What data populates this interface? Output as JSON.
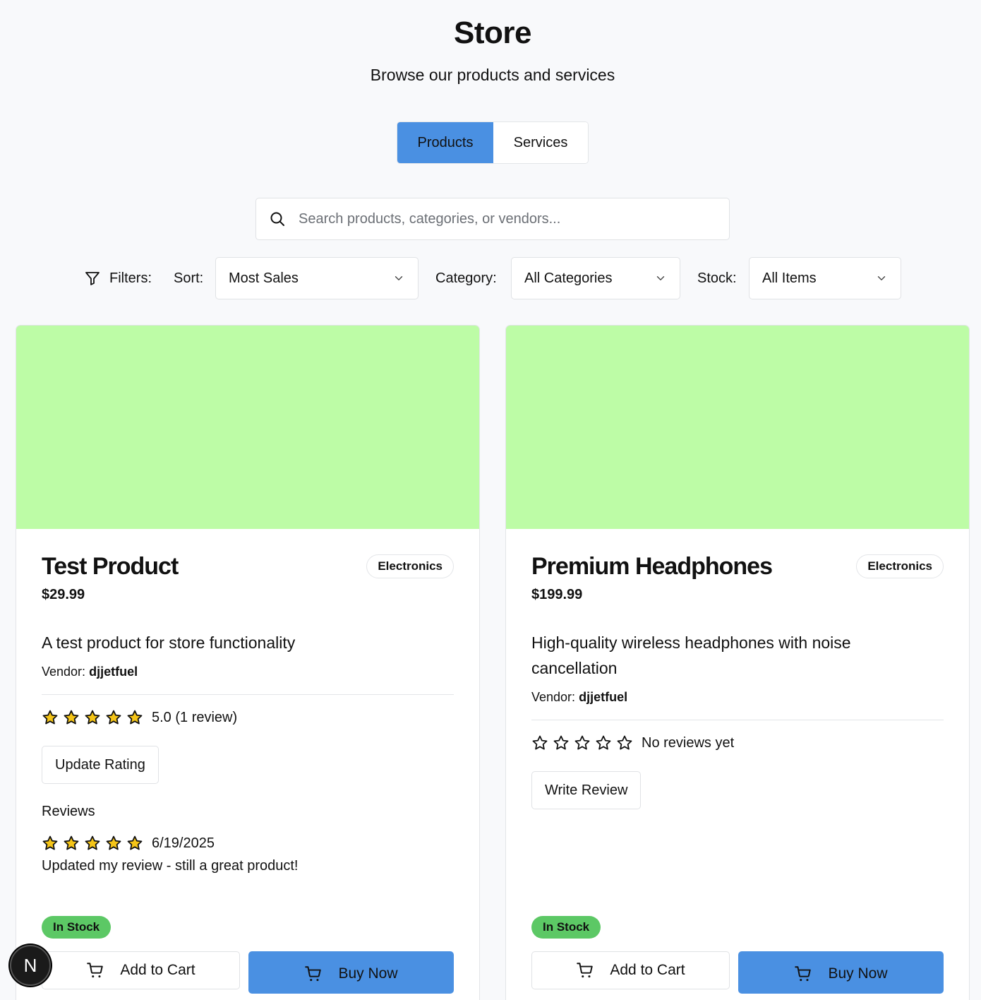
{
  "header": {
    "title": "Store",
    "subtitle": "Browse our products and services"
  },
  "tabs": [
    {
      "label": "Products",
      "active": true
    },
    {
      "label": "Services",
      "active": false
    }
  ],
  "search": {
    "placeholder": "Search products, categories, or vendors...",
    "value": ""
  },
  "filters": {
    "label": "Filters:",
    "sort_label": "Sort:",
    "sort_value": "Most Sales",
    "category_label": "Category:",
    "category_value": "All Categories",
    "stock_label": "Stock:",
    "stock_value": "All Items"
  },
  "products": [
    {
      "name": "Test Product",
      "category": "Electronics",
      "price": "$29.99",
      "description": "A test product for store functionality",
      "vendor_label": "Vendor:",
      "vendor": "djjetfuel",
      "rating": 5,
      "rating_text": "5.0 (1 review)",
      "review_button": "Update Rating",
      "reviews_title": "Reviews",
      "reviews": [
        {
          "rating": 5,
          "date": "6/19/2025",
          "text": "Updated my review - still a great product!"
        }
      ],
      "stock": "In Stock",
      "add_to_cart": "Add to Cart",
      "buy_now": "Buy Now",
      "image_color": "#bdfca6"
    },
    {
      "name": "Premium Headphones",
      "category": "Electronics",
      "price": "$199.99",
      "description": "High-quality wireless headphones with noise cancellation",
      "vendor_label": "Vendor:",
      "vendor": "djjetfuel",
      "rating": 0,
      "rating_text": "No reviews yet",
      "review_button": "Write Review",
      "stock": "In Stock",
      "add_to_cart": "Add to Cart",
      "buy_now": "Buy Now",
      "image_color": "#bdfca6"
    }
  ],
  "dev_badge": {
    "label": "N"
  },
  "colors": {
    "accent": "#4a90e2",
    "in_stock": "#5cc865",
    "star_fill": "#f5c518",
    "image_placeholder": "#bdfca6"
  },
  "icons": {
    "search": "search-icon",
    "filter": "filter-icon",
    "chevron": "chevron-down-icon",
    "star": "star-icon",
    "cart": "cart-icon"
  }
}
